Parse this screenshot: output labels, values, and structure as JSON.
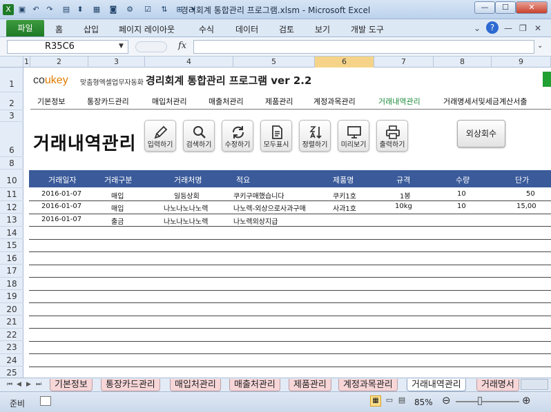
{
  "window": {
    "title": "경리회계 통합관리 프로그램.xlsm - Microsoft Excel",
    "min": "—",
    "max": "☐",
    "close": "✕"
  },
  "ribbon": {
    "file": "파일",
    "tabs": [
      "홈",
      "삽입",
      "페이지 레이아웃",
      "수식",
      "데이터",
      "검토",
      "보기",
      "개발 도구"
    ]
  },
  "formula": {
    "namebox": "R35C6",
    "fx": "fx",
    "value": ""
  },
  "columns": [
    "1",
    "2",
    "3",
    "4",
    "5",
    "6",
    "7",
    "8",
    "9"
  ],
  "rows": [
    "1",
    "2",
    "3",
    "6",
    "8",
    "10",
    "11",
    "12",
    "13",
    "14",
    "15",
    "16",
    "17",
    "18",
    "19",
    "20",
    "21",
    "22",
    "23",
    "24",
    "25"
  ],
  "header": {
    "logo_co": "co",
    "logo_ukey": "ukey",
    "logo_sub": "맞춤형엑셀업무자동화",
    "title": "경리회계 통합관리 프로그램 ver 2.2"
  },
  "nav": [
    "기본정보",
    "통장카드관리",
    "매입처관리",
    "매출처관리",
    "제품관리",
    "계정과목관리",
    "거래내역관리",
    "거래명세서및세금계산서출"
  ],
  "nav_active": "거래내역관리",
  "page_title": "거래내역관리",
  "tools": [
    {
      "label": "입력하기",
      "icon": "pencil-icon"
    },
    {
      "label": "검색하기",
      "icon": "search-icon"
    },
    {
      "label": "수정하기",
      "icon": "refresh-icon"
    },
    {
      "label": "모두표시",
      "icon": "document-icon"
    },
    {
      "label": "정렬하기",
      "icon": "sort-icon"
    },
    {
      "label": "미리보기",
      "icon": "monitor-icon"
    },
    {
      "label": "출력하기",
      "icon": "printer-icon"
    }
  ],
  "outer_button": "외상회수",
  "table": {
    "headers": [
      "거래일자",
      "거래구분",
      "거래처명",
      "적요",
      "제품명",
      "규격",
      "수량",
      "단가"
    ],
    "rows": [
      [
        "2016-01-07",
        "매입",
        "일등상회",
        "쿠키구매했습니다",
        "쿠키1호",
        "1봉",
        "10",
        "50"
      ],
      [
        "2016-01-07",
        "매입",
        "나노나노나노렉",
        "나노렉-외상으로사과구매",
        "사과1호",
        "10kg",
        "10",
        "15,00"
      ],
      [
        "2016-01-07",
        "출금",
        "나노나노나노렉",
        "나노렉외상지급",
        "",
        "",
        "",
        ""
      ]
    ]
  },
  "sheet_tabs": [
    "기본정보",
    "통장카드관리",
    "매입처관리",
    "매출처관리",
    "제품관리",
    "계정과목관리",
    "거래내역관리",
    "거래명서"
  ],
  "sheet_active": "거래내역관리",
  "status": {
    "ready": "준비",
    "zoom": "85%"
  },
  "colors": {
    "accent_green": "#21a033",
    "table_header": "#3a5a9a",
    "sheet_tab": "#f7d6d8"
  }
}
